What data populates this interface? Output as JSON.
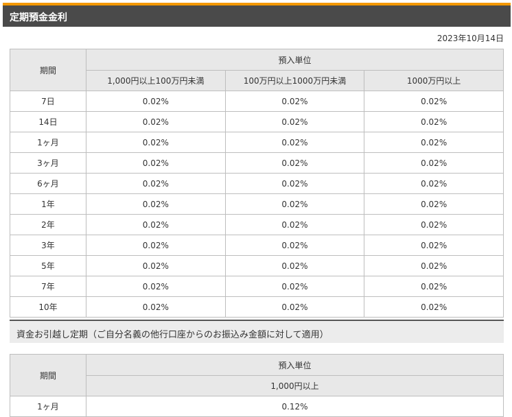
{
  "header": {
    "title": "定期預金金利"
  },
  "date": "2023年10月14日",
  "rates_table": {
    "period_header": "期間",
    "unit_header": "預入単位",
    "columns": [
      "1,000円以上100万円未満",
      "100万円以上1000万円未満",
      "1000万円以上"
    ],
    "rows": [
      {
        "period": "7日",
        "values": [
          "0.02%",
          "0.02%",
          "0.02%"
        ]
      },
      {
        "period": "14日",
        "values": [
          "0.02%",
          "0.02%",
          "0.02%"
        ]
      },
      {
        "period": "1ヶ月",
        "values": [
          "0.02%",
          "0.02%",
          "0.02%"
        ]
      },
      {
        "period": "3ヶ月",
        "values": [
          "0.02%",
          "0.02%",
          "0.02%"
        ]
      },
      {
        "period": "6ヶ月",
        "values": [
          "0.02%",
          "0.02%",
          "0.02%"
        ]
      },
      {
        "period": "1年",
        "values": [
          "0.02%",
          "0.02%",
          "0.02%"
        ]
      },
      {
        "period": "2年",
        "values": [
          "0.02%",
          "0.02%",
          "0.02%"
        ]
      },
      {
        "period": "3年",
        "values": [
          "0.02%",
          "0.02%",
          "0.02%"
        ]
      },
      {
        "period": "5年",
        "values": [
          "0.02%",
          "0.02%",
          "0.02%"
        ]
      },
      {
        "period": "7年",
        "values": [
          "0.02%",
          "0.02%",
          "0.02%"
        ]
      },
      {
        "period": "10年",
        "values": [
          "0.02%",
          "0.02%",
          "0.02%"
        ]
      }
    ]
  },
  "transfer_section": {
    "title": "資金お引越し定期（ご自分名義の他行口座からのお振込み金額に対して適用）",
    "period_header": "期間",
    "unit_header": "預入単位",
    "column": "1,000円以上",
    "rows": [
      {
        "period": "1ヶ月",
        "value": "0.12%"
      }
    ]
  }
}
